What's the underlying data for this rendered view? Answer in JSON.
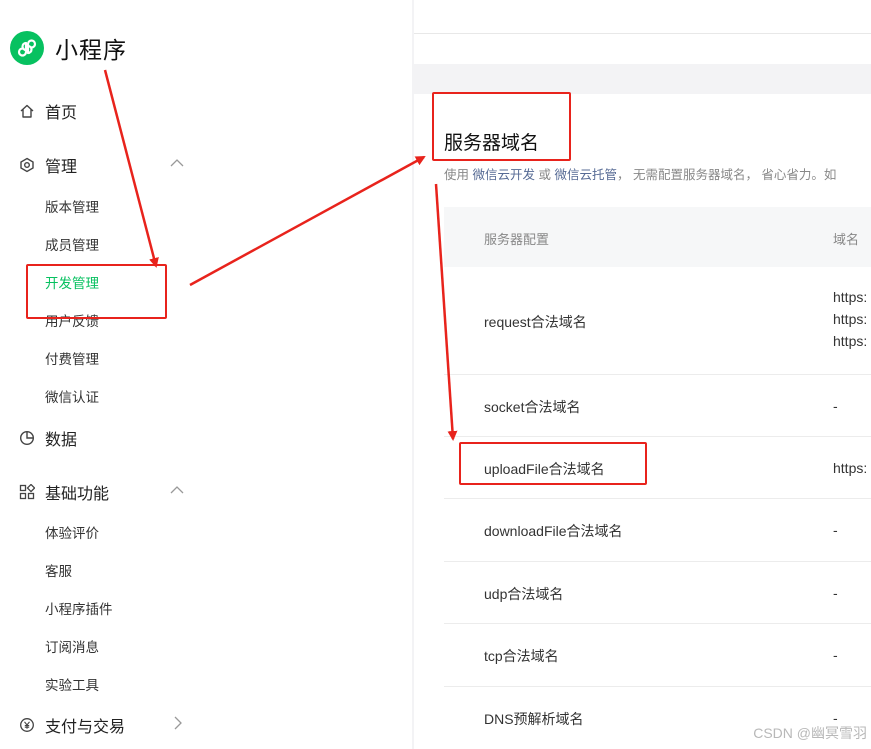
{
  "app": {
    "title": "小程序"
  },
  "sidebar": {
    "home": "首页",
    "manage": {
      "label": "管理",
      "items": [
        "版本管理",
        "成员管理",
        "开发管理",
        "用户反馈",
        "付费管理",
        "微信认证"
      ],
      "active_index": 2
    },
    "data": "数据",
    "basic": {
      "label": "基础功能",
      "items": [
        "体验评价",
        "客服",
        "小程序插件",
        "订阅消息",
        "实验工具"
      ]
    },
    "pay": "支付与交易"
  },
  "section": {
    "title": "服务器域名",
    "desc_prefix": "使用 ",
    "link1": "微信云开发",
    "desc_or": " 或 ",
    "link2": "微信云托管",
    "desc_suffix": "， 无需配置服务器域名， 省心省力。如"
  },
  "table": {
    "headers": [
      "服务器配置",
      "域名"
    ],
    "rows": [
      {
        "name": "request合法域名",
        "values": [
          "https:",
          "https:",
          "https:"
        ]
      },
      {
        "name": "socket合法域名",
        "values": [
          "-"
        ]
      },
      {
        "name": "uploadFile合法域名",
        "values": [
          "https:"
        ]
      },
      {
        "name": "downloadFile合法域名",
        "values": [
          "-"
        ]
      },
      {
        "name": "udp合法域名",
        "values": [
          "-"
        ]
      },
      {
        "name": "tcp合法域名",
        "values": [
          "-"
        ]
      },
      {
        "name": "DNS预解析域名",
        "values": [
          "-"
        ]
      }
    ]
  },
  "watermark": "CSDN @幽冥雪羽",
  "colors": {
    "accent": "#07c160",
    "annotation": "#e8231c",
    "link": "#576b95"
  },
  "icons": [
    "miniprogram-logo-icon",
    "home-icon",
    "settings-icon",
    "chevron-up-icon",
    "pie-chart-icon",
    "grid-icon",
    "yen-icon",
    "chevron-right-icon"
  ]
}
